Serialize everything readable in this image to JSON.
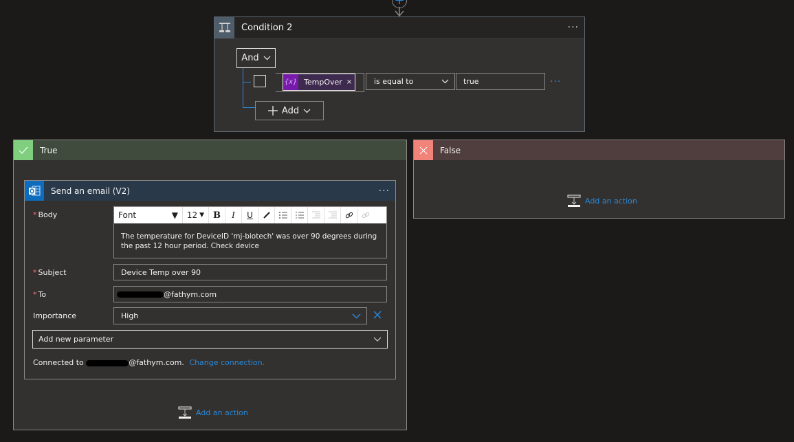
{
  "condition": {
    "title": "Condition 2",
    "more_label": "···",
    "group_operator": "And",
    "rows": [
      {
        "token": {
          "icon": "variable-icon",
          "icon_text": "{x}",
          "label": "TempOver",
          "remove": "×"
        },
        "operator": "is equal to",
        "value": "true"
      }
    ],
    "add_label": "Add"
  },
  "true_branch": {
    "title": "True",
    "status_color": "#7fcf7f",
    "action": {
      "title": "Send an email (V2)",
      "more_label": "···",
      "fields": {
        "body": {
          "label": "Body",
          "required": "*",
          "toolbar": {
            "font": "Font",
            "size": "12",
            "bold": "B",
            "italic": "I",
            "underline": "U"
          },
          "text": "The temperature for DeviceID 'mj-biotech' was over 90 degrees during the past 12 hour period. Check device"
        },
        "subject": {
          "label": "Subject",
          "required": "*",
          "value": "Device Temp over 90"
        },
        "to": {
          "label": "To",
          "required": "*",
          "value_suffix": "@fathym.com"
        },
        "importance": {
          "label": "Importance",
          "value": "High"
        },
        "add_param": {
          "placeholder": "Add new parameter"
        }
      },
      "connection": {
        "prefix": "Connected to ",
        "suffix": "@fathym.com.",
        "change_link": "Change connection."
      }
    },
    "add_action_label": "Add an action"
  },
  "false_branch": {
    "title": "False",
    "status_color": "#f1837b",
    "add_action_label": "Add an action"
  },
  "colors": {
    "accent": "#2b88d8",
    "background": "#1b1a19",
    "card": "#323130"
  }
}
